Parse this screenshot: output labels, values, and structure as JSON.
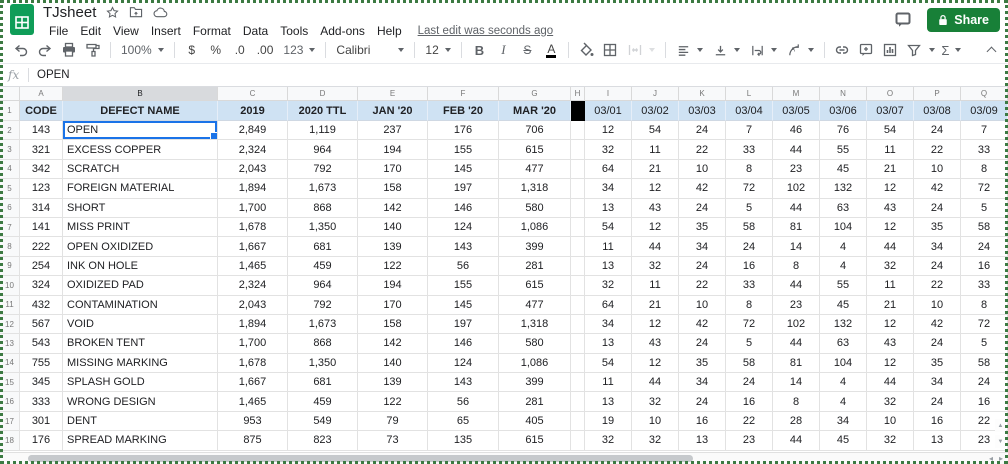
{
  "titlebar": {
    "title": "TJsheet",
    "menus": [
      "File",
      "Edit",
      "View",
      "Insert",
      "Format",
      "Data",
      "Tools",
      "Add-ons",
      "Help"
    ],
    "last_edit_text": "Last edit was seconds ago",
    "share_label": "Share"
  },
  "toolbar": {
    "zoom_value": "100%",
    "currency_label": "$",
    "percent_label": "%",
    "decimal_decrease_label": ".0",
    "decimal_increase_label": ".00",
    "number_format_label": "123",
    "font_name": "Calibri",
    "font_size": "12",
    "bold_label": "B",
    "italic_label": "I",
    "strikethrough_label": "S",
    "text_color_label": "A",
    "functions_label": "Σ"
  },
  "formula_bar": {
    "fx_label": "fx",
    "value": "OPEN"
  },
  "grid": {
    "selected_cell": "B2",
    "column_letters": [
      "A",
      "B",
      "C",
      "D",
      "E",
      "F",
      "G",
      "H",
      "I",
      "J",
      "K",
      "L",
      "M",
      "N",
      "O",
      "P",
      "Q"
    ],
    "row_numbers": [
      "1",
      "2",
      "3",
      "4",
      "5",
      "6",
      "7",
      "8",
      "9",
      "10",
      "11",
      "12",
      "13",
      "14",
      "15",
      "16",
      "17",
      "18"
    ],
    "header_labels": [
      "CODE",
      "DEFECT NAME",
      "2019",
      "2020 TTL",
      "JAN '20",
      "FEB '20",
      "MAR '20",
      "03/01",
      "03/02",
      "03/03",
      "03/04",
      "03/05",
      "03/06",
      "03/07",
      "03/08",
      "03/09"
    ],
    "rows": [
      [
        "143",
        "OPEN",
        "2,849",
        "1,119",
        "237",
        "176",
        "706",
        "12",
        "54",
        "24",
        "7",
        "46",
        "76",
        "54",
        "24",
        "7"
      ],
      [
        "321",
        "EXCESS COPPER",
        "2,324",
        "964",
        "194",
        "155",
        "615",
        "32",
        "11",
        "22",
        "33",
        "44",
        "55",
        "11",
        "22",
        "33"
      ],
      [
        "342",
        "SCRATCH",
        "2,043",
        "792",
        "170",
        "145",
        "477",
        "64",
        "21",
        "10",
        "8",
        "23",
        "45",
        "21",
        "10",
        "8"
      ],
      [
        "123",
        "FOREIGN MATERIAL",
        "1,894",
        "1,673",
        "158",
        "197",
        "1,318",
        "34",
        "12",
        "42",
        "72",
        "102",
        "132",
        "12",
        "42",
        "72"
      ],
      [
        "314",
        "SHORT",
        "1,700",
        "868",
        "142",
        "146",
        "580",
        "13",
        "43",
        "24",
        "5",
        "44",
        "63",
        "43",
        "24",
        "5"
      ],
      [
        "141",
        "MISS PRINT",
        "1,678",
        "1,350",
        "140",
        "124",
        "1,086",
        "54",
        "12",
        "35",
        "58",
        "81",
        "104",
        "12",
        "35",
        "58"
      ],
      [
        "222",
        "OPEN OXIDIZED",
        "1,667",
        "681",
        "139",
        "143",
        "399",
        "11",
        "44",
        "34",
        "24",
        "14",
        "4",
        "44",
        "34",
        "24"
      ],
      [
        "254",
        "INK ON HOLE",
        "1,465",
        "459",
        "122",
        "56",
        "281",
        "13",
        "32",
        "24",
        "16",
        "8",
        "4",
        "32",
        "24",
        "16"
      ],
      [
        "324",
        "OXIDIZED PAD",
        "2,324",
        "964",
        "194",
        "155",
        "615",
        "32",
        "11",
        "22",
        "33",
        "44",
        "55",
        "11",
        "22",
        "33"
      ],
      [
        "432",
        "CONTAMINATION",
        "2,043",
        "792",
        "170",
        "145",
        "477",
        "64",
        "21",
        "10",
        "8",
        "23",
        "45",
        "21",
        "10",
        "8"
      ],
      [
        "567",
        "VOID",
        "1,894",
        "1,673",
        "158",
        "197",
        "1,318",
        "34",
        "12",
        "42",
        "72",
        "102",
        "132",
        "12",
        "42",
        "72"
      ],
      [
        "543",
        "BROKEN TENT",
        "1,700",
        "868",
        "142",
        "146",
        "580",
        "13",
        "43",
        "24",
        "5",
        "44",
        "63",
        "43",
        "24",
        "5"
      ],
      [
        "755",
        "MISSING MARKING",
        "1,678",
        "1,350",
        "140",
        "124",
        "1,086",
        "54",
        "12",
        "35",
        "58",
        "81",
        "104",
        "12",
        "35",
        "58"
      ],
      [
        "345",
        "SPLASH GOLD",
        "1,667",
        "681",
        "139",
        "143",
        "399",
        "11",
        "44",
        "34",
        "24",
        "14",
        "4",
        "44",
        "34",
        "24"
      ],
      [
        "333",
        "WRONG DESIGN",
        "1,465",
        "459",
        "122",
        "56",
        "281",
        "13",
        "32",
        "24",
        "16",
        "8",
        "4",
        "32",
        "24",
        "16"
      ],
      [
        "301",
        "DENT",
        "953",
        "549",
        "79",
        "65",
        "405",
        "19",
        "10",
        "16",
        "22",
        "28",
        "34",
        "10",
        "16",
        "22"
      ],
      [
        "176",
        "SPREAD MARKING",
        "875",
        "823",
        "73",
        "135",
        "615",
        "32",
        "32",
        "13",
        "23",
        "44",
        "45",
        "32",
        "13",
        "23"
      ]
    ]
  },
  "colors": {
    "header_fill": "#cfe2f3",
    "selection_blue": "#1a73e8",
    "share_green": "#188038",
    "black_cell": "#000000",
    "logo_green": "#0f9d58",
    "capture_border": "#3c7a42",
    "gridline": "#e2e2e2",
    "gutter_bg": "#f8f9fa",
    "icon_gray": "#5f6368"
  }
}
